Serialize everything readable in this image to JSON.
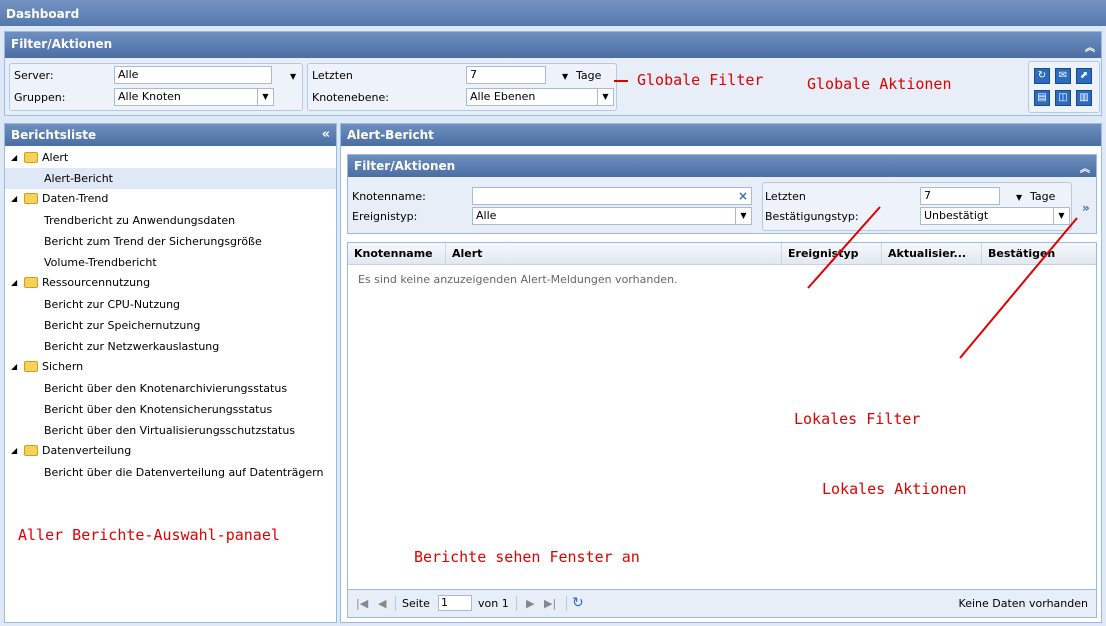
{
  "app": {
    "title": "Dashboard"
  },
  "global_panel": {
    "title": "Filter/Aktionen",
    "server_label": "Server:",
    "server_value": "Alle",
    "groups_label": "Gruppen:",
    "groups_value": "Alle Knoten",
    "last_label": "Letzten",
    "last_value": "7",
    "days_label": "Tage",
    "level_label": "Knotenebene:",
    "level_value": "Alle Ebenen"
  },
  "annotations": {
    "global_filter": "Globale Filter",
    "global_actions": "Globale Aktionen",
    "local_filter": "Lokales Filter",
    "local_actions": "Lokales Aktionen",
    "report_view": "Berichte sehen Fenster an",
    "report_select": "Aller Berichte-Auswahl-panael"
  },
  "report_list": {
    "title": "Berichtsliste",
    "groups": [
      {
        "label": "Alert",
        "items": [
          "Alert-Bericht"
        ]
      },
      {
        "label": "Daten-Trend",
        "items": [
          "Trendbericht zu Anwendungsdaten",
          "Bericht zum Trend der Sicherungsgröße",
          "Volume-Trendbericht"
        ]
      },
      {
        "label": "Ressourcennutzung",
        "items": [
          "Bericht zur CPU-Nutzung",
          "Bericht zur Speichernutzung",
          "Bericht zur Netzwerkauslastung"
        ]
      },
      {
        "label": "Sichern",
        "items": [
          "Bericht über den Knotenarchivierungsstatus",
          "Bericht über den Knotensicherungsstatus",
          "Bericht über den Virtualisierungsschutzstatus"
        ]
      },
      {
        "label": "Datenverteilung",
        "items": [
          "Bericht über die Datenverteilung auf Datenträgern"
        ]
      }
    ]
  },
  "report_view": {
    "title": "Alert-Bericht",
    "local_panel": {
      "title": "Filter/Aktionen",
      "node_label": "Knotenname:",
      "node_value": "",
      "event_label": "Ereignistyp:",
      "event_value": "Alle",
      "last_label": "Letzten",
      "last_value": "7",
      "days_label": "Tage",
      "confirm_label": "Bestätigungstyp:",
      "confirm_value": "Unbestätigt"
    },
    "columns": [
      "Knotenname",
      "Alert",
      "Ereignistyp",
      "Aktualisier...",
      "Bestätigen"
    ],
    "empty_message": "Es sind keine anzuzeigenden Alert-Meldungen vorhanden.",
    "pager": {
      "page_label": "Seite",
      "page_value": "1",
      "of_label": "von 1",
      "status": "Keine Daten vorhanden"
    }
  },
  "colors": {
    "header": "#5478ad",
    "annotation": "#e00000"
  }
}
